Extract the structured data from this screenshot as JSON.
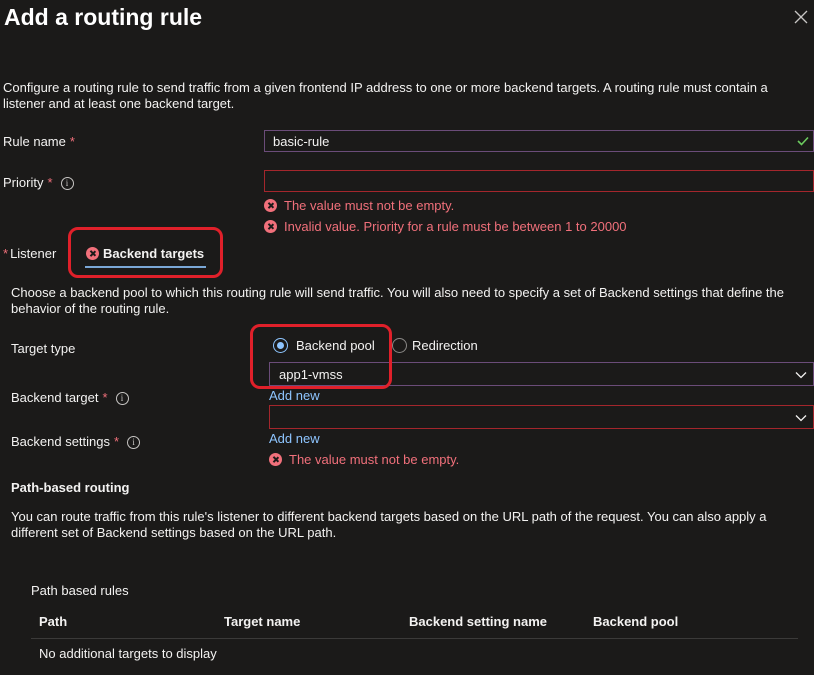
{
  "header": {
    "title": "Add a routing rule",
    "close_icon": "close-icon"
  },
  "description": "Configure a routing rule to send traffic from a given frontend IP address to one or more backend targets. A routing rule must contain a listener and at least one backend target.",
  "rule_name": {
    "label": "Rule name",
    "required_mark": "*",
    "value": "basic-rule",
    "valid_icon": "checkmark-icon"
  },
  "priority": {
    "label": "Priority",
    "required_mark": "*",
    "info_glyph": "i",
    "value": "",
    "errors": [
      "The value must not be empty.",
      "Invalid value. Priority for a rule must be between 1 to 20000"
    ]
  },
  "tabs": {
    "listener_required_mark": "*",
    "listener": "Listener",
    "backend_targets": "Backend targets"
  },
  "backend": {
    "description": "Choose a backend pool to which this routing rule will send traffic. You will also need to specify a set of Backend settings that define the behavior of the routing rule.",
    "target_type_label": "Target type",
    "target_type_options": [
      "Backend pool",
      "Redirection"
    ],
    "target_type_selected": "Backend pool",
    "pool_value": "app1-vmss",
    "backend_target_label": "Backend target",
    "backend_target_required": "*",
    "add_new_1": "Add new",
    "backend_target_value": "",
    "backend_settings_label": "Backend settings",
    "backend_settings_required": "*",
    "add_new_2": "Add new",
    "backend_settings_error": "The value must not be empty.",
    "info_glyph": "i"
  },
  "path_routing": {
    "heading": "Path-based routing",
    "description": "You can route traffic from this rule's listener to different backend targets based on the URL path of the request. You can also apply a different set of Backend settings based on the URL path.",
    "rules_title": "Path based rules",
    "columns": [
      "Path",
      "Target name",
      "Backend setting name",
      "Backend pool"
    ],
    "empty_text": "No additional targets to display"
  },
  "colors": {
    "background": "#1b1a19",
    "accent": "#8ec5ff",
    "error": "#f1707b",
    "annotation": "#e0202a",
    "input_border": "#6b4c79"
  }
}
